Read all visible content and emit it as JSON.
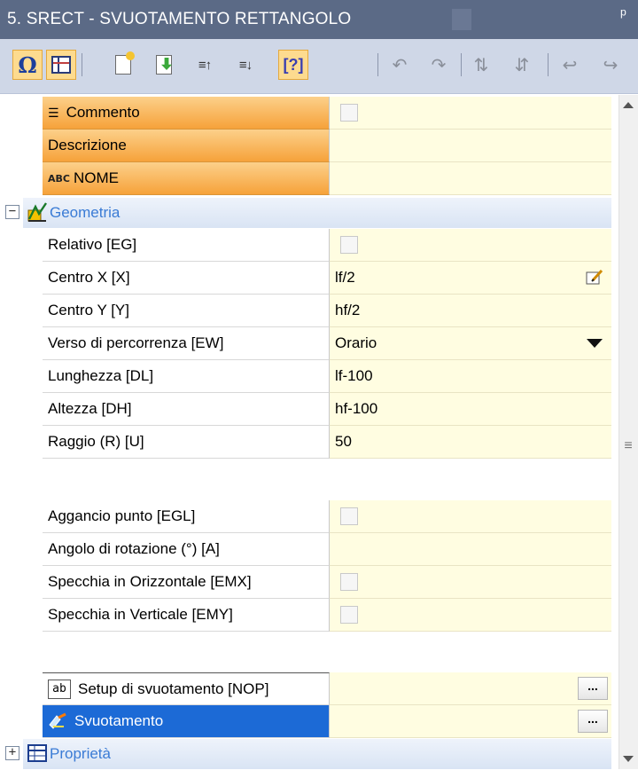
{
  "window": {
    "title": "5. SRECT - SVUOTAMENTO RETTANGOLO",
    "pin_icon": "pin-icon"
  },
  "toolbar": {
    "buttons": [
      {
        "icon": "omega-icon",
        "glyph": "Ω",
        "active": true
      },
      {
        "icon": "grid-icon",
        "active": true
      },
      {
        "icon": "new-document-icon",
        "active": false
      },
      {
        "icon": "import-icon",
        "active": false
      },
      {
        "icon": "move-up-lines-icon",
        "glyph": "≡↑",
        "active": false
      },
      {
        "icon": "move-down-lines-icon",
        "glyph": "≡↓",
        "active": false
      },
      {
        "icon": "bracket-help-icon",
        "glyph": "[?]",
        "active": true
      },
      {
        "icon": "rotate-left-icon",
        "glyph": "↶",
        "active": false
      },
      {
        "icon": "rotate-right-icon",
        "glyph": "↷",
        "active": false
      },
      {
        "icon": "sort-up-icon",
        "glyph": "⇅",
        "active": false
      },
      {
        "icon": "sort-down-icon",
        "glyph": "⇵",
        "active": false
      },
      {
        "icon": "undo-icon",
        "glyph": "↩",
        "active": false
      },
      {
        "icon": "redo-icon",
        "glyph": "↪",
        "active": false
      }
    ]
  },
  "grid": {
    "header_rows": [
      {
        "label": "Commento",
        "value_type": "checkbox"
      },
      {
        "label": "Descrizione",
        "value": ""
      },
      {
        "label": "NOME",
        "prefix": "ABC",
        "value": ""
      }
    ],
    "geometry": {
      "section_label": "Geometria",
      "expander": "−",
      "rows": [
        {
          "label": "Relativo [EG]",
          "value_type": "checkbox"
        },
        {
          "label": "Centro X [X]",
          "value": "lf/2",
          "has_edit": true
        },
        {
          "label": "Centro Y [Y]",
          "value": "hf/2"
        },
        {
          "label": "Verso di percorrenza [EW]",
          "value": "Orario",
          "has_dropdown": true
        },
        {
          "label": "Lunghezza [DL]",
          "value": "lf-100"
        },
        {
          "label": "Altezza [DH]",
          "value": "hf-100"
        },
        {
          "label": "Raggio (R) [U]",
          "value": "50"
        }
      ],
      "rows2": [
        {
          "label": "Aggancio punto [EGL]",
          "value_type": "checkbox"
        },
        {
          "label": "Angolo di rotazione (°) [A]",
          "value": ""
        },
        {
          "label": "Specchia in Orizzontale [EMX]",
          "value_type": "checkbox"
        },
        {
          "label": "Specchia in Verticale [EMY]",
          "value_type": "checkbox"
        }
      ],
      "rows3": [
        {
          "label": "Setup di svuotamento [NOP]",
          "prefix": "ab",
          "button": "..."
        },
        {
          "label": "Svuotamento",
          "button": "...",
          "selected": true
        }
      ]
    },
    "properties": {
      "section_label": "Proprietà",
      "expander": "+"
    }
  },
  "colors": {
    "title_bar": "#5b6a86",
    "toolbar": "#cfd7e7",
    "orange_header": "#f6a23a",
    "value_bg": "#fffde1",
    "selected": "#1c6ad6",
    "section_text": "#3a7bd5"
  }
}
